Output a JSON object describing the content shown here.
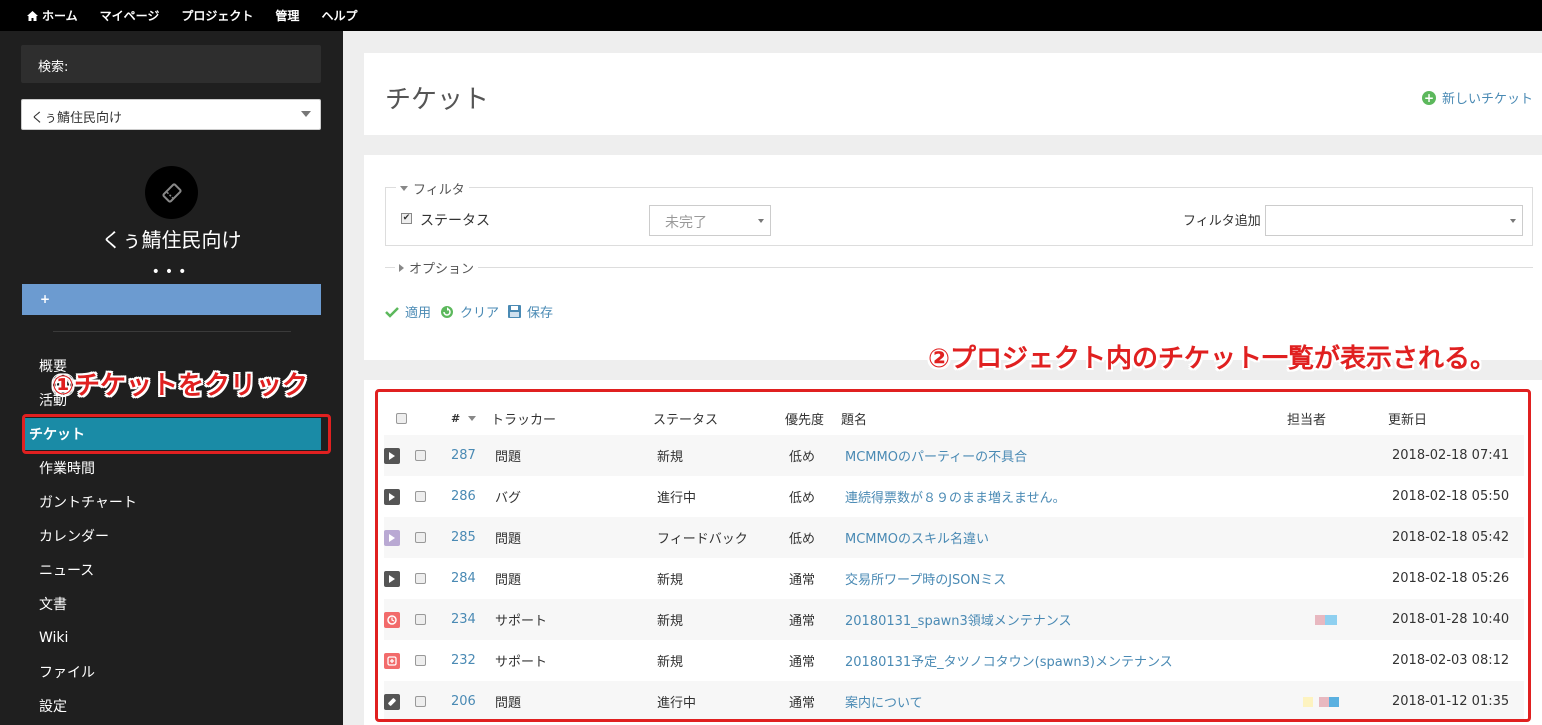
{
  "topnav": {
    "items": [
      "ホーム",
      "マイページ",
      "プロジェクト",
      "管理",
      "ヘルプ"
    ]
  },
  "sidebar": {
    "search_label": "検索:",
    "project_select_value": "くぅ鯖住民向け",
    "project_name": "くぅ鯖住民向け",
    "dots": "•••",
    "plus_label": "+",
    "menu": [
      {
        "label": "概要",
        "active": false
      },
      {
        "label": "活動",
        "active": false
      },
      {
        "label": "チケット",
        "active": true
      },
      {
        "label": "作業時間",
        "active": false
      },
      {
        "label": "ガントチャート",
        "active": false
      },
      {
        "label": "カレンダー",
        "active": false
      },
      {
        "label": "ニュース",
        "active": false
      },
      {
        "label": "文書",
        "active": false
      },
      {
        "label": "Wiki",
        "active": false
      },
      {
        "label": "ファイル",
        "active": false
      },
      {
        "label": "設定",
        "active": false
      }
    ]
  },
  "annotations": {
    "left": "①チケットをクリック",
    "right": "②プロジェクト内のチケット一覧が表示される。"
  },
  "header": {
    "title": "チケット",
    "new_issue_label": "新しいチケット"
  },
  "filters": {
    "legend": "フィルタ",
    "status_label": "ステータス",
    "status_value": "未完了",
    "add_filter_label": "フィルタ追加",
    "options_legend": "オプション",
    "apply_label": "適用",
    "clear_label": "クリア",
    "save_label": "保存"
  },
  "table": {
    "columns": [
      "#",
      "トラッカー",
      "ステータス",
      "優先度",
      "題名",
      "担当者",
      "更新日"
    ],
    "rows": [
      {
        "id": "287",
        "tracker": "問題",
        "tracker_icon": "play-icon",
        "tracker_color": "#555555",
        "status": "新規",
        "priority": "低め",
        "subject": "MCMMOのパーティーの不具合",
        "updated": "2018-02-18 07:41",
        "assignee_avatar": false
      },
      {
        "id": "286",
        "tracker": "バグ",
        "tracker_icon": "play-icon",
        "tracker_color": "#555555",
        "status": "進行中",
        "priority": "低め",
        "subject": "連続得票数が８９のまま増えません。",
        "updated": "2018-02-18 05:50",
        "assignee_avatar": false
      },
      {
        "id": "285",
        "tracker": "問題",
        "tracker_icon": "play-icon",
        "tracker_color": "#b9a9d3",
        "status": "フィードバック",
        "priority": "低め",
        "subject": "MCMMOのスキル名違い",
        "updated": "2018-02-18 05:42",
        "assignee_avatar": false
      },
      {
        "id": "284",
        "tracker": "問題",
        "tracker_icon": "play-icon",
        "tracker_color": "#555555",
        "status": "新規",
        "priority": "通常",
        "subject": "交易所ワープ時のJSONミス",
        "updated": "2018-02-18 05:26",
        "assignee_avatar": false
      },
      {
        "id": "234",
        "tracker": "サポート",
        "tracker_icon": "clock-icon",
        "tracker_color": "#f26b6b",
        "status": "新規",
        "priority": "通常",
        "subject": "20180131_spawn3領域メンテナンス",
        "updated": "2018-01-28 10:40",
        "assignee_avatar": true
      },
      {
        "id": "232",
        "tracker": "サポート",
        "tracker_icon": "plus-box-icon",
        "tracker_color": "#f26b6b",
        "status": "新規",
        "priority": "通常",
        "subject": "20180131予定_タツノコタウン(spawn3)メンテナンス",
        "updated": "2018-02-03 08:12",
        "assignee_avatar": false
      },
      {
        "id": "206",
        "tracker": "問題",
        "tracker_icon": "tag-icon",
        "tracker_color": "#555555",
        "status": "進行中",
        "priority": "通常",
        "subject": "案内について",
        "updated": "2018-01-12 01:35",
        "assignee_avatar": true
      }
    ]
  }
}
